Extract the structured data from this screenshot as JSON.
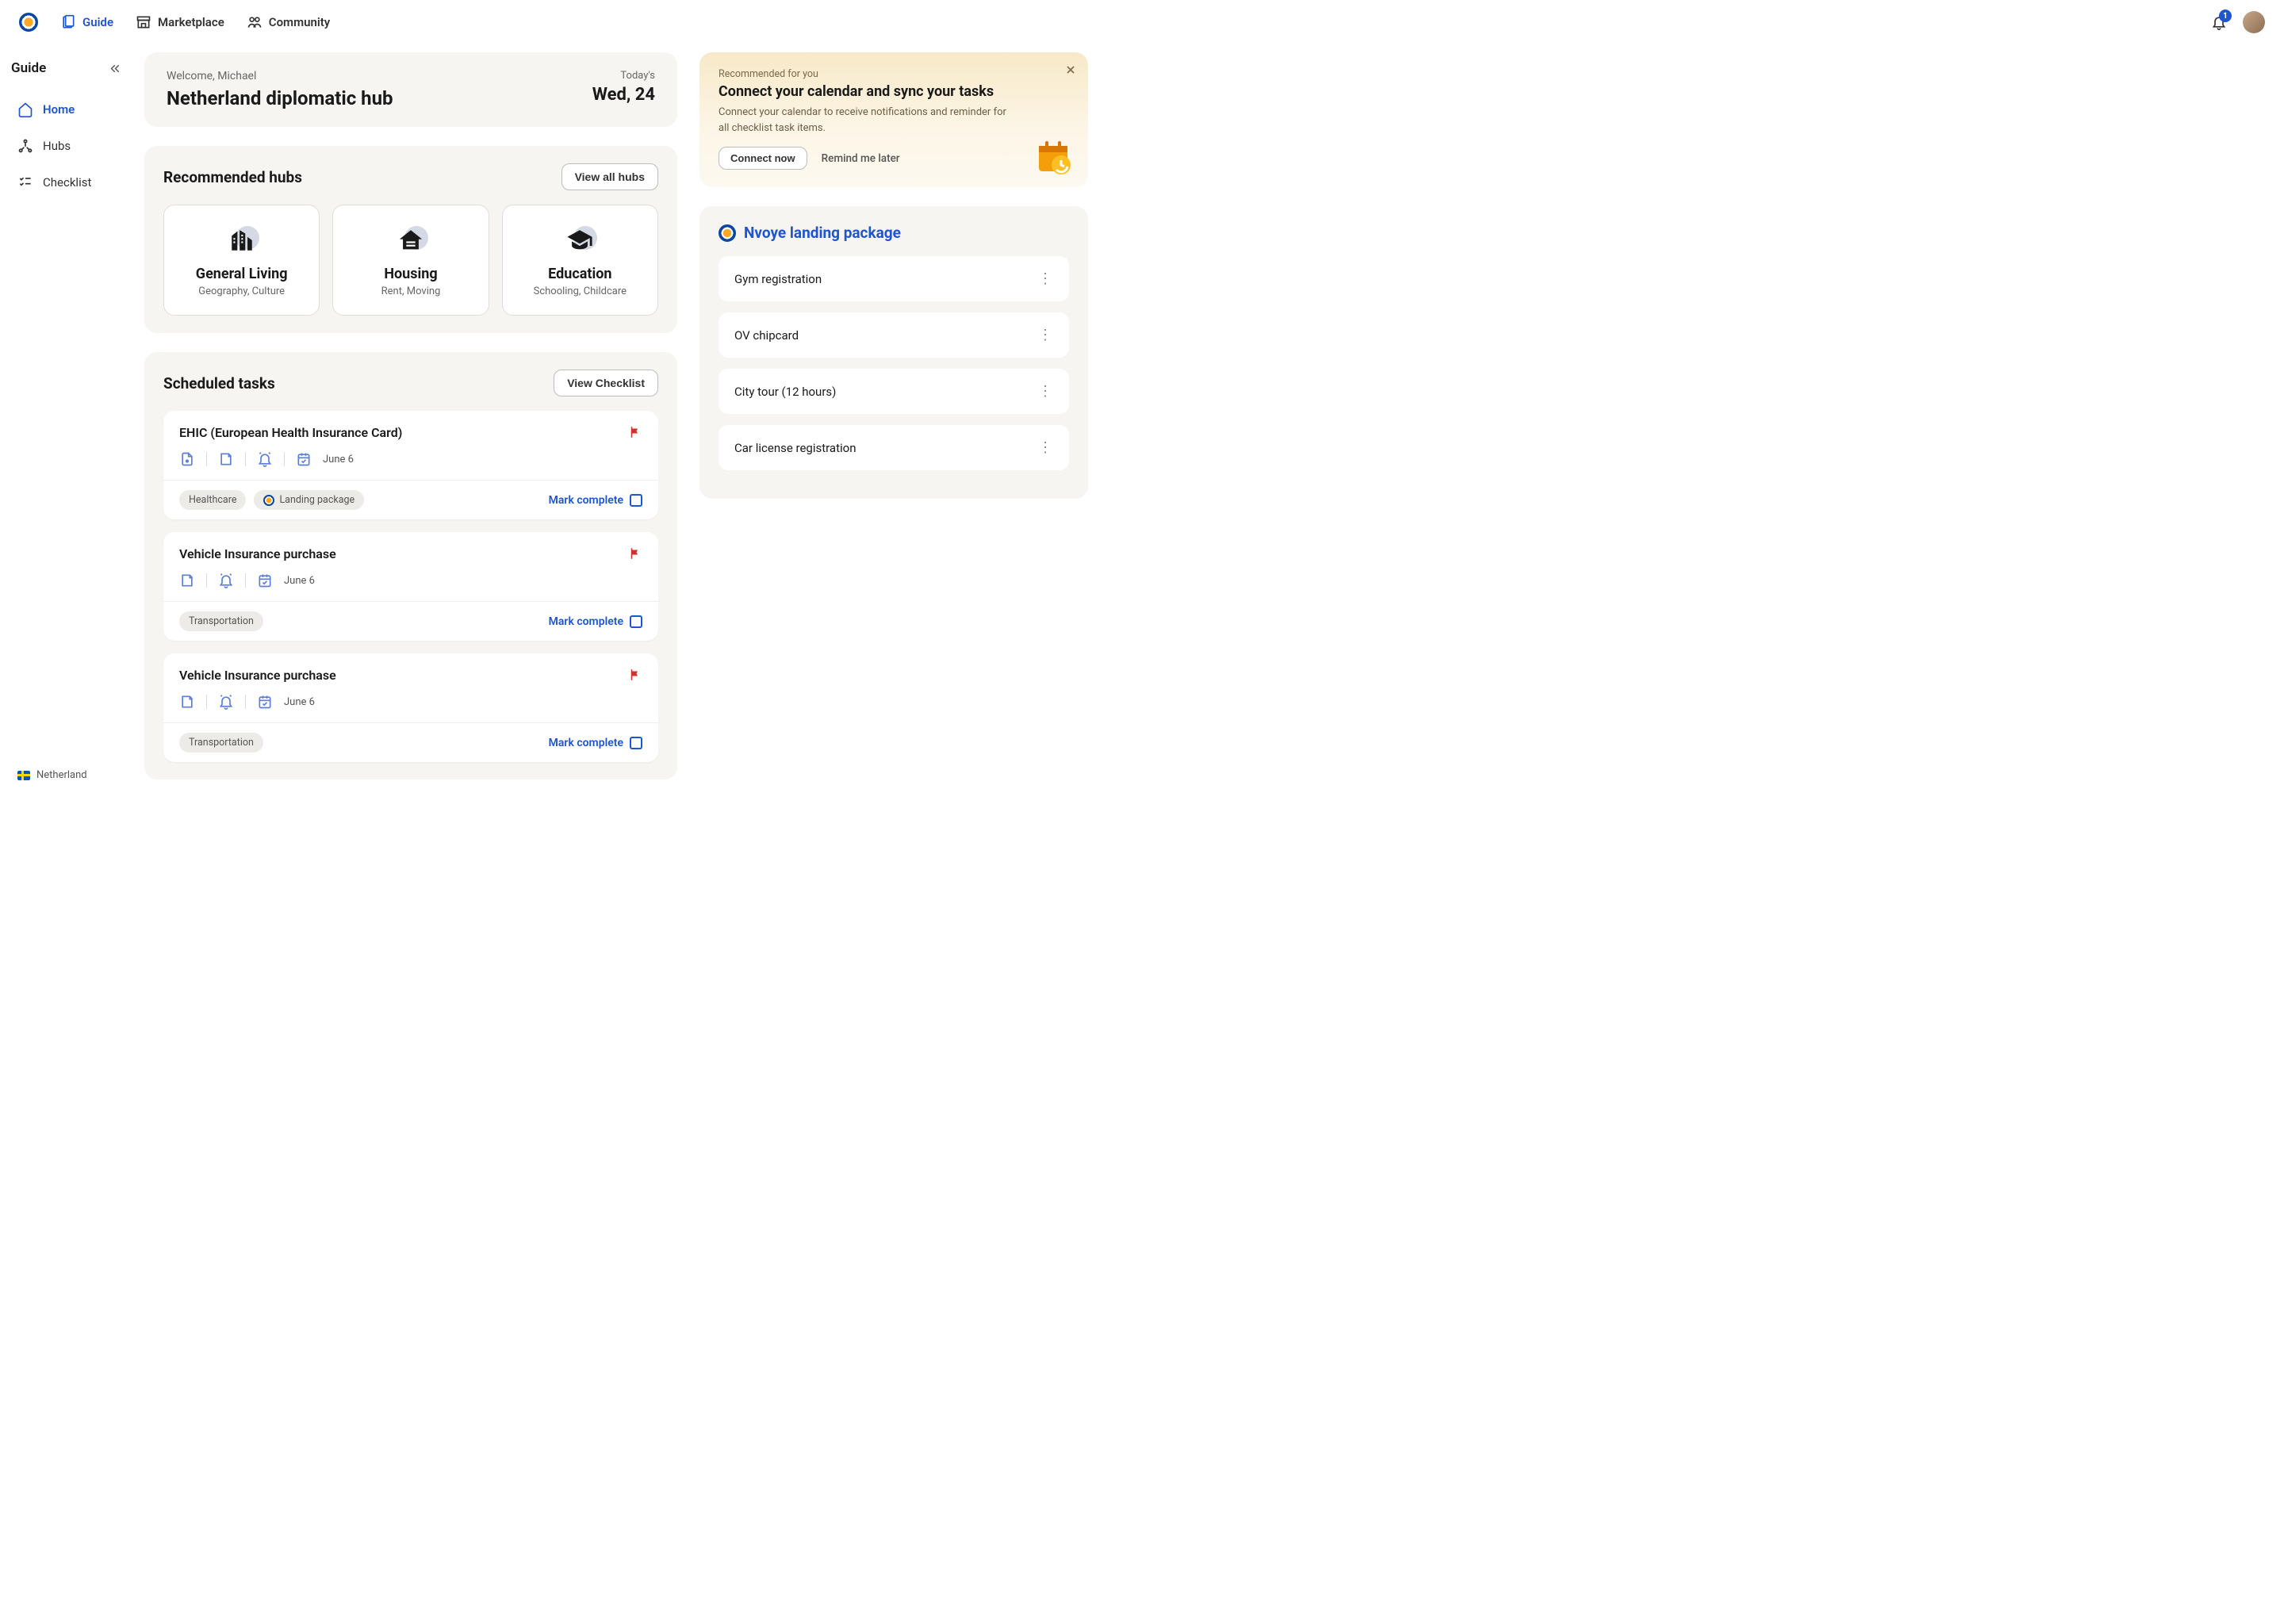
{
  "nav": {
    "guide": "Guide",
    "marketplace": "Marketplace",
    "community": "Community",
    "notification_count": "1"
  },
  "sidebar": {
    "title": "Guide",
    "items": {
      "home": "Home",
      "hubs": "Hubs",
      "checklist": "Checklist"
    },
    "footer_country": "Netherland"
  },
  "hero": {
    "welcome": "Welcome, Michael",
    "title": "Netherland diplomatic hub",
    "today_label": "Today's",
    "date": "Wed, 24"
  },
  "hubs": {
    "heading": "Recommended hubs",
    "view_all": "View all hubs",
    "cards": [
      {
        "title": "General Living",
        "sub": "Geography, Culture"
      },
      {
        "title": "Housing",
        "sub": "Rent, Moving"
      },
      {
        "title": "Education",
        "sub": "Schooling, Childcare"
      }
    ]
  },
  "tasks": {
    "heading": "Scheduled tasks",
    "view_checklist": "View Checklist",
    "mark_complete": "Mark complete",
    "list": [
      {
        "title": "EHIC (European Health Insurance Card)",
        "date": "June 6",
        "tags": [
          "Healthcare",
          "Landing package"
        ],
        "has_attach": true,
        "has_note": true,
        "has_bell": true,
        "landing_tag_index": 1
      },
      {
        "title": "Vehicle Insurance purchase",
        "date": "June 6",
        "tags": [
          "Transportation"
        ],
        "has_attach": false,
        "has_note": true,
        "has_bell": true
      },
      {
        "title": "Vehicle Insurance purchase",
        "date": "June 6",
        "tags": [
          "Transportation"
        ],
        "has_attach": false,
        "has_note": true,
        "has_bell": true
      }
    ]
  },
  "callout": {
    "rec": "Recommended for you",
    "title": "Connect your calendar and sync your tasks",
    "body": "Connect your calendar to receive notifications and reminder for all checklist task items.",
    "connect": "Connect now",
    "remind": "Remind me later"
  },
  "package": {
    "title": "Nvoye landing package",
    "items": [
      "Gym registration",
      "OV chipcard",
      "City tour (12 hours)",
      "Car license registration"
    ]
  }
}
